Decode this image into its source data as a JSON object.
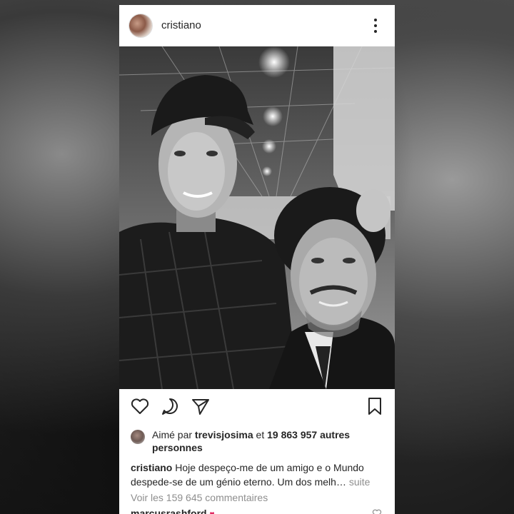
{
  "post": {
    "username": "cristiano"
  },
  "likes": {
    "prefix": "Aimé par",
    "user": "trevisjosima",
    "connector": "et",
    "count": "19 863 957 autres personnes"
  },
  "caption": {
    "user": "cristiano",
    "text": "Hoje despeço-me de um amigo e o Mundo despede-se de um génio eterno. Um dos melh…",
    "more": "suite"
  },
  "comments": {
    "view_all": "Voir les 159 645 commentaires",
    "first_user": "marcusrashford"
  },
  "icons": {
    "more": "more-vertical-icon",
    "like": "heart-icon",
    "comment": "comment-icon",
    "share": "send-icon",
    "save": "bookmark-icon"
  },
  "colors": {
    "text": "#262626",
    "muted": "#8e8e8e",
    "heart_emoji": "#e0245e"
  }
}
